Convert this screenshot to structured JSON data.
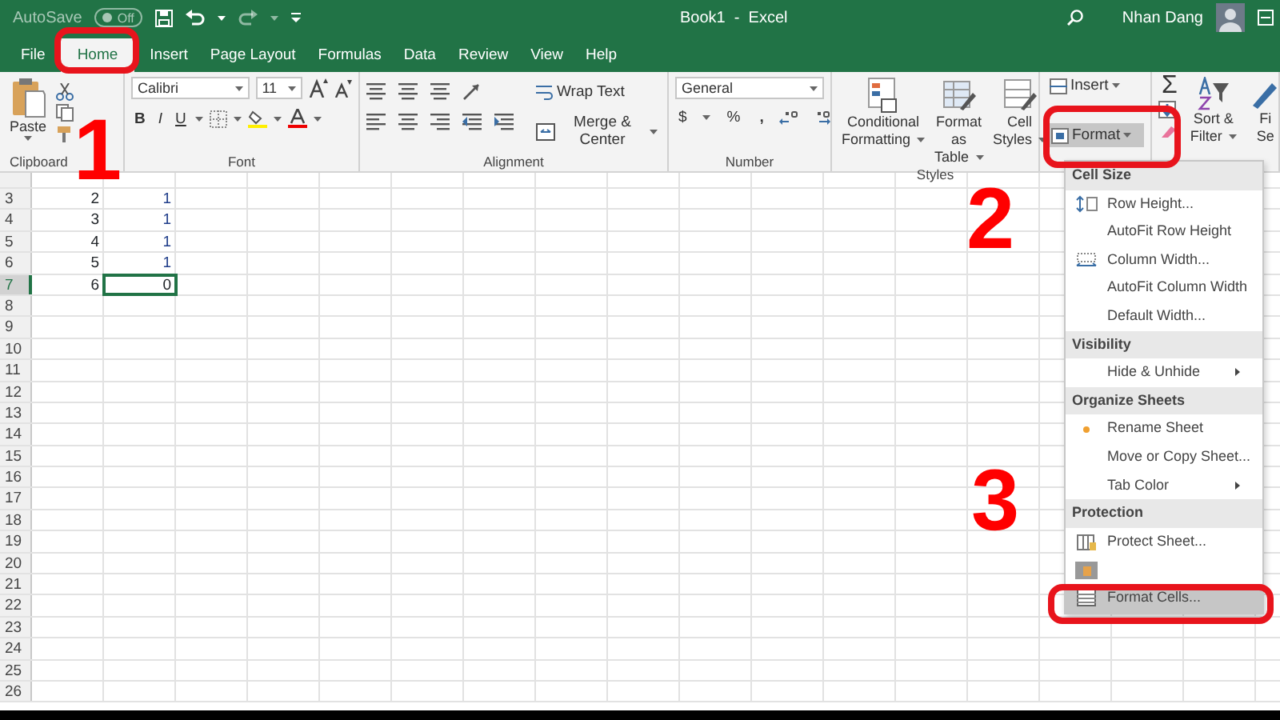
{
  "title_bar": {
    "autosave_label": "AutoSave",
    "autosave_toggle": {
      "label": "Off",
      "on": false
    },
    "document_title": "Book1  -  Excel",
    "user_name": "Nhan Dang"
  },
  "tabs": [
    {
      "label": "File",
      "selected": false
    },
    {
      "label": "Home",
      "selected": true
    },
    {
      "label": "Insert",
      "selected": false
    },
    {
      "label": "Page Layout",
      "selected": false
    },
    {
      "label": "Formulas",
      "selected": false
    },
    {
      "label": "Data",
      "selected": false
    },
    {
      "label": "Review",
      "selected": false
    },
    {
      "label": "View",
      "selected": false
    },
    {
      "label": "Help",
      "selected": false
    }
  ],
  "ribbon": {
    "clipboard": {
      "paste_label": "Paste",
      "group_label": "Clipboard"
    },
    "font": {
      "font_name": "Calibri",
      "font_size": "11",
      "bold": "B",
      "italic": "I",
      "underline": "U",
      "group_label": "Font"
    },
    "alignment": {
      "wrap_text": "Wrap Text",
      "merge_center": "Merge & Center",
      "group_label": "Alignment"
    },
    "number": {
      "format": "General",
      "currency": "$",
      "percent": "%",
      "comma": ",",
      "group_label": "Number"
    },
    "styles": {
      "buttons": [
        {
          "lines": [
            "Conditional",
            "Formatting"
          ]
        },
        {
          "lines": [
            "Format as",
            "Table"
          ]
        },
        {
          "lines": [
            "Cell",
            "Styles"
          ]
        }
      ],
      "group_label": "Styles"
    },
    "cells": {
      "insert": "Insert",
      "format": {
        "label": "Format",
        "expanded": true
      }
    },
    "editing": {
      "autosum": "Σ",
      "buttons": [
        {
          "lines": [
            "Sort &",
            "Filter"
          ]
        },
        {
          "lines": [
            "Fi",
            "Se"
          ]
        }
      ]
    }
  },
  "sheet": {
    "rows": [
      {
        "number": "3",
        "cells": [
          "2",
          "1"
        ],
        "selected": false
      },
      {
        "number": "4",
        "cells": [
          "3",
          "1"
        ],
        "selected": false
      },
      {
        "number": "5",
        "cells": [
          "4",
          "1"
        ],
        "selected": false
      },
      {
        "number": "6",
        "cells": [
          "5",
          "1"
        ],
        "selected": false
      },
      {
        "number": "7",
        "cells": [
          "6",
          "0"
        ],
        "selected": true
      },
      {
        "number": "8",
        "cells": [],
        "selected": false
      },
      {
        "number": "9",
        "cells": [],
        "selected": false
      },
      {
        "number": "10",
        "cells": [],
        "selected": false
      },
      {
        "number": "11",
        "cells": [],
        "selected": false
      },
      {
        "number": "12",
        "cells": [],
        "selected": false
      },
      {
        "number": "13",
        "cells": [],
        "selected": false
      },
      {
        "number": "14",
        "cells": [],
        "selected": false
      },
      {
        "number": "15",
        "cells": [],
        "selected": false
      },
      {
        "number": "16",
        "cells": [],
        "selected": false
      },
      {
        "number": "17",
        "cells": [],
        "selected": false
      },
      {
        "number": "18",
        "cells": [],
        "selected": false
      },
      {
        "number": "19",
        "cells": [],
        "selected": false
      },
      {
        "number": "20",
        "cells": [],
        "selected": false
      },
      {
        "number": "21",
        "cells": [],
        "selected": false
      },
      {
        "number": "22",
        "cells": [],
        "selected": false
      },
      {
        "number": "23",
        "cells": [],
        "selected": false
      },
      {
        "number": "24",
        "cells": [],
        "selected": false
      },
      {
        "number": "25",
        "cells": [],
        "selected": false
      },
      {
        "number": "26",
        "cells": [],
        "selected": false
      }
    ]
  },
  "format_menu": {
    "items": [
      {
        "kind": "header",
        "label": "Cell Size"
      },
      {
        "kind": "row-height",
        "label": "Row Height...",
        "selected": false
      },
      {
        "kind": "plain",
        "label": "AutoFit Row Height",
        "selected": false
      },
      {
        "kind": "column-width",
        "label": "Column Width...",
        "selected": false
      },
      {
        "kind": "plain",
        "label": "AutoFit Column Width",
        "selected": false
      },
      {
        "kind": "plain",
        "label": "Default Width...",
        "selected": false
      },
      {
        "kind": "header",
        "label": "Visibility"
      },
      {
        "kind": "submenu",
        "label": "Hide & Unhide",
        "selected": false
      },
      {
        "kind": "header",
        "label": "Organize Sheets"
      },
      {
        "kind": "bullet",
        "label": "Rename Sheet",
        "selected": false
      },
      {
        "kind": "plain",
        "label": "Move or Copy Sheet...",
        "selected": false
      },
      {
        "kind": "submenu",
        "label": "Tab Color",
        "selected": false
      },
      {
        "kind": "header",
        "label": "Protection"
      },
      {
        "kind": "protect",
        "label": "Protect Sheet...",
        "selected": false
      },
      {
        "kind": "lock",
        "selected": false
      },
      {
        "kind": "format-cells",
        "label": "Format Cells...",
        "selected": true
      }
    ]
  },
  "annotations": [
    {
      "label": "1"
    },
    {
      "label": "2"
    },
    {
      "label": "3"
    }
  ]
}
